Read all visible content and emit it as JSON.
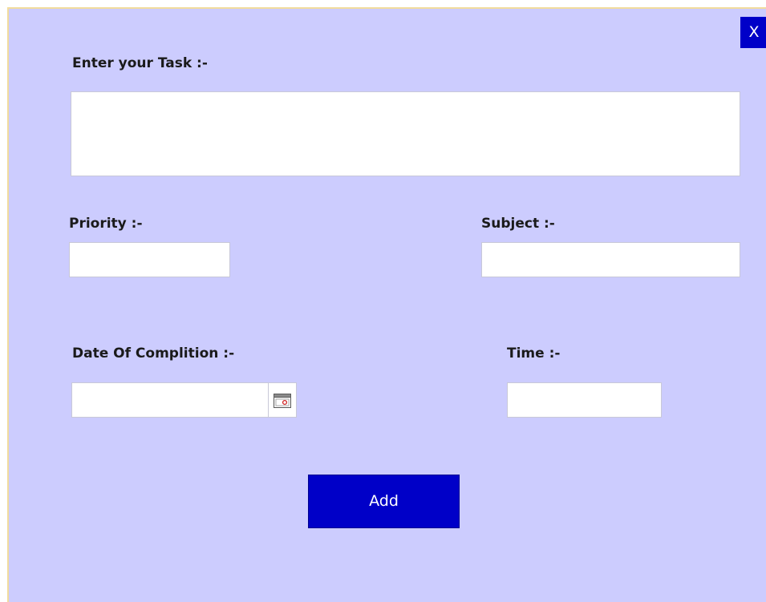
{
  "dialog": {
    "close_label": "X",
    "task": {
      "label": "Enter your Task :-",
      "value": ""
    },
    "priority": {
      "label": "Priority :-",
      "value": ""
    },
    "subject": {
      "label": "Subject :-",
      "value": ""
    },
    "date": {
      "label": "Date Of Complition :-",
      "value": ""
    },
    "time": {
      "label": "Time :-",
      "value": ""
    },
    "add_label": "Add"
  },
  "icons": {
    "date_picker": "calendar-icon"
  },
  "colors": {
    "background": "#ccccfe",
    "button": "#0000c8",
    "button_text": "#ffffff",
    "border": "#f2dc9c"
  }
}
